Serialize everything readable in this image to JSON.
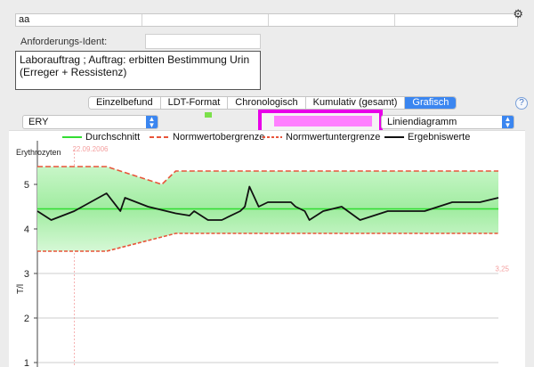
{
  "top_field": {
    "value": "aa"
  },
  "ident": {
    "label": "Anforderungs-Ident:",
    "value": ""
  },
  "auftrag": {
    "line1": "Laborauftrag ; Auftrag: erbitten Bestimmung Urin",
    "line2": "(Erreger + Ressistenz)"
  },
  "tabs": [
    {
      "label": "Einzelbefund",
      "active": false
    },
    {
      "label": "LDT-Format",
      "active": false
    },
    {
      "label": "Chronologisch",
      "active": false
    },
    {
      "label": "Kumulativ (gesamt)",
      "active": false
    },
    {
      "label": "Grafisch",
      "active": true
    }
  ],
  "help_label": "?",
  "parameter_select": {
    "value": "ERY"
  },
  "chart_type_select": {
    "value": "Liniendiagramm"
  },
  "colors": {
    "accent": "#3b86f0",
    "highlight": "#e800e8",
    "mean": "#33dd33",
    "range_fill": "#b8f0b8",
    "limit": "#e8553a"
  },
  "legend": {
    "mean": "Durchschnitt",
    "upper": "Normwertobergrenze",
    "lower": "Normwertuntergrenze",
    "results": "Ergebniswerte"
  },
  "chart_data": {
    "type": "line",
    "title": "Erythrozyten",
    "ylabel": "T/l",
    "ylim": [
      1,
      5.5
    ],
    "yticks": [
      1,
      2,
      3,
      4,
      5
    ],
    "date_label": "22.09.2006",
    "min_label": "3,25",
    "x": [
      0,
      3,
      8,
      15,
      18,
      19,
      24,
      30,
      33,
      34,
      37,
      40,
      44,
      45,
      46,
      48,
      50,
      55,
      56,
      58,
      59,
      62,
      64,
      66,
      70,
      76,
      80,
      84,
      90,
      96,
      100
    ],
    "series": [
      {
        "name": "Ergebniswerte",
        "values": [
          4.4,
          4.2,
          4.4,
          4.8,
          4.4,
          4.7,
          4.5,
          4.35,
          4.3,
          4.4,
          4.2,
          4.2,
          4.4,
          4.5,
          4.95,
          4.5,
          4.6,
          4.6,
          4.5,
          4.4,
          4.2,
          4.4,
          4.45,
          4.5,
          4.2,
          4.4,
          4.4,
          4.4,
          4.6,
          4.6,
          4.7
        ]
      }
    ],
    "mean": 4.45,
    "upper_limit": {
      "x": [
        0,
        15,
        27,
        30,
        100
      ],
      "values": [
        5.4,
        5.4,
        5.0,
        5.3,
        5.3
      ]
    },
    "lower_limit": {
      "x": [
        0,
        15,
        30,
        100
      ],
      "values": [
        3.5,
        3.5,
        3.9,
        3.9
      ]
    }
  }
}
